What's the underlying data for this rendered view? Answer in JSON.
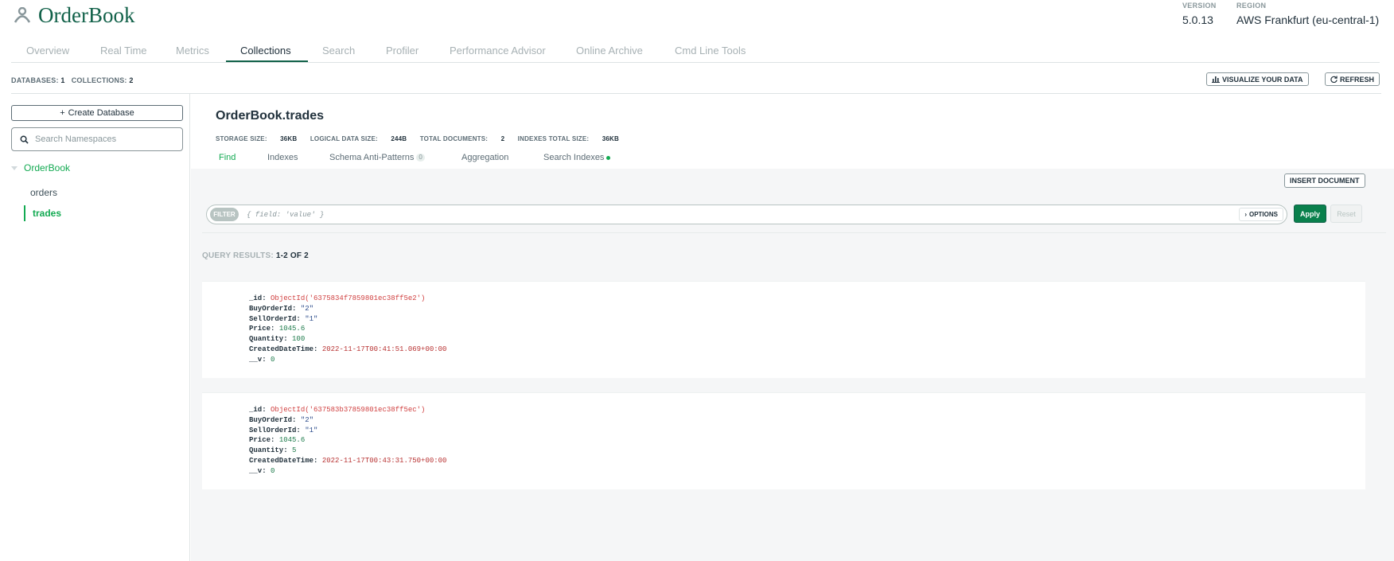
{
  "app": {
    "title": "OrderBook"
  },
  "meta": {
    "version_label": "VERSION",
    "version": "5.0.13",
    "region_label": "REGION",
    "region": "AWS Frankfurt (eu-central-1)"
  },
  "tabs": [
    "Overview",
    "Real Time",
    "Metrics",
    "Collections",
    "Search",
    "Profiler",
    "Performance Advisor",
    "Online Archive",
    "Cmd Line Tools"
  ],
  "stats": {
    "databases_label": "DATABASES:",
    "databases": "1",
    "collections_label": "COLLECTIONS:",
    "collections": "2"
  },
  "toolbar": {
    "visualize": "VISUALIZE YOUR DATA",
    "refresh": "REFRESH"
  },
  "sidebar": {
    "create_db": "Create Database",
    "search_placeholder": "Search Namespaces",
    "database": "OrderBook",
    "collections": [
      "orders",
      "trades"
    ]
  },
  "namespace": {
    "title": "OrderBook.trades",
    "storage_label": "STORAGE SIZE:",
    "storage": "36KB",
    "logical_label": "LOGICAL DATA SIZE:",
    "logical": "244B",
    "docs_label": "TOTAL DOCUMENTS:",
    "docs": "2",
    "indexes_label": "INDEXES TOTAL SIZE:",
    "indexes": "36KB"
  },
  "subtabs": {
    "find": "Find",
    "indexes": "Indexes",
    "schema": "Schema Anti-Patterns",
    "schema_count": "0",
    "aggregation": "Aggregation",
    "search_indexes": "Search Indexes"
  },
  "find": {
    "insert": "INSERT DOCUMENT",
    "filter_pill": "FILTER",
    "filter_placeholder": "{ field: 'value' }",
    "options": "OPTIONS",
    "apply": "Apply",
    "reset": "Reset",
    "results_label": "QUERY RESULTS:",
    "results_value": "1-2 OF 2"
  },
  "documents": [
    {
      "id_key": "_id:",
      "id": "ObjectId('6375834f7859801ec38ff5e2')",
      "buy_key": "BuyOrderId:",
      "buy": "\"2\"",
      "sell_key": "SellOrderId:",
      "sell": "\"1\"",
      "price_key": "Price:",
      "price": "1045.6",
      "qty_key": "Quantity:",
      "qty": "100",
      "created_key": "CreatedDateTime:",
      "created": "2022-11-17T00:41:51.069+00:00",
      "v_key": "__v:",
      "v": "0"
    },
    {
      "id_key": "_id:",
      "id": "ObjectId('637583b37859801ec38ff5ec')",
      "buy_key": "BuyOrderId:",
      "buy": "\"2\"",
      "sell_key": "SellOrderId:",
      "sell": "\"1\"",
      "price_key": "Price:",
      "price": "1045.6",
      "qty_key": "Quantity:",
      "qty": "5",
      "created_key": "CreatedDateTime:",
      "created": "2022-11-17T00:43:31.750+00:00",
      "v_key": "__v:",
      "v": "0"
    }
  ]
}
